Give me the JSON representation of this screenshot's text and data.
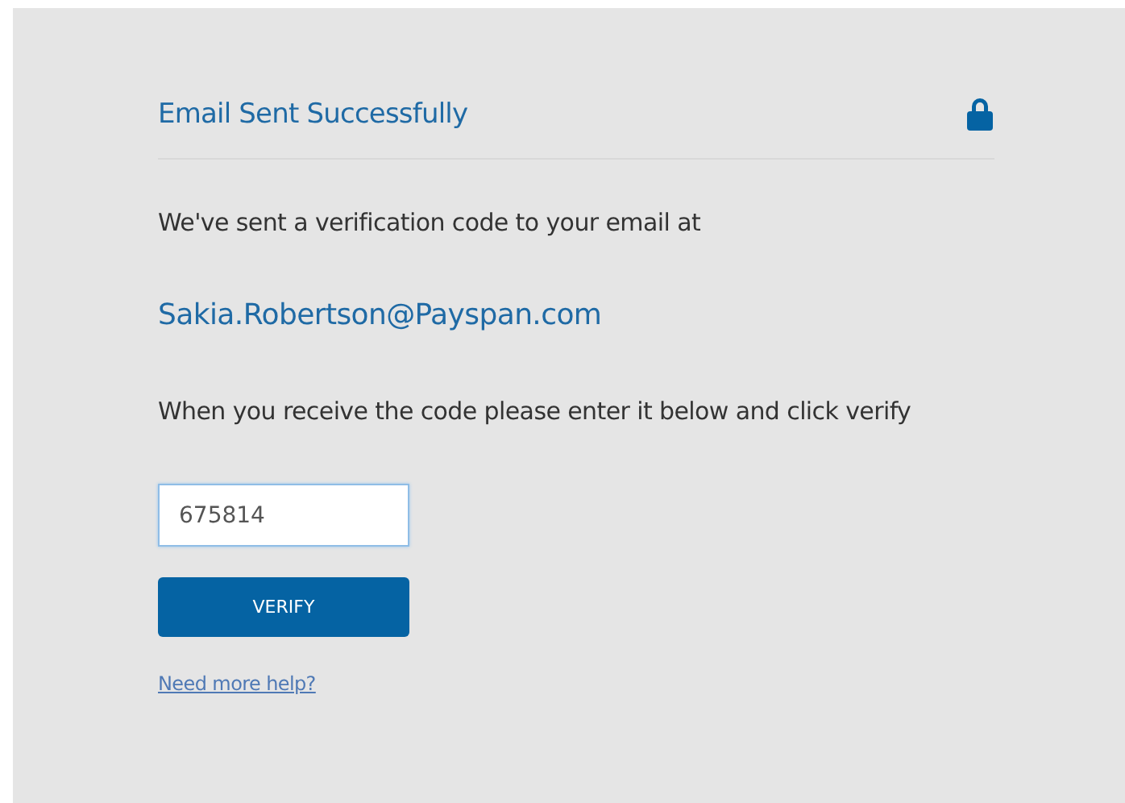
{
  "title": "Email Sent Successfully",
  "message": "We've sent a verification code to your email at",
  "email": "Sakia.Robertson@Payspan.com",
  "instruction": "When you receive the code please enter it below and click verify",
  "code_field": {
    "value": "675814",
    "focused": true
  },
  "verify_button": "VERIFY",
  "help_link": "Need more help?"
}
